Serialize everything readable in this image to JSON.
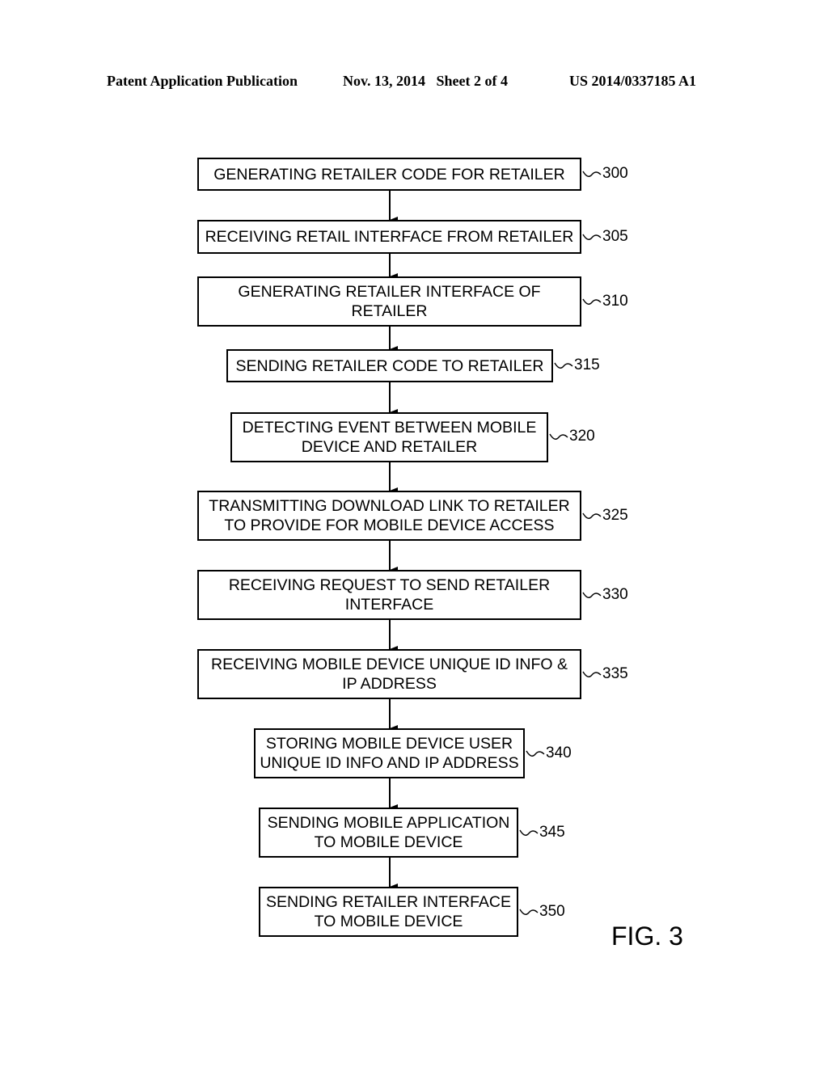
{
  "header": {
    "publication": "Patent Application Publication",
    "date_sheet": "Nov. 13, 2014   Sheet 2 of 4",
    "number": "US 2014/0337185 A1"
  },
  "figure_label": "FIG. 3",
  "steps": [
    {
      "ref": "300",
      "text": "GENERATING RETAILER CODE FOR RETAILER"
    },
    {
      "ref": "305",
      "text": "RECEIVING RETAIL INTERFACE FROM RETAILER"
    },
    {
      "ref": "310",
      "text": "GENERATING RETAILER INTERFACE OF\nRETAILER"
    },
    {
      "ref": "315",
      "text": "SENDING RETAILER CODE TO RETAILER"
    },
    {
      "ref": "320",
      "text": "DETECTING EVENT BETWEEN MOBILE\nDEVICE AND RETAILER"
    },
    {
      "ref": "325",
      "text": "TRANSMITTING DOWNLOAD LINK TO RETAILER\nTO PROVIDE FOR MOBILE DEVICE ACCESS"
    },
    {
      "ref": "330",
      "text": "RECEIVING REQUEST TO SEND RETAILER\nINTERFACE"
    },
    {
      "ref": "335",
      "text": "RECEIVING MOBILE DEVICE UNIQUE ID INFO &\nIP ADDRESS"
    },
    {
      "ref": "340",
      "text": "STORING MOBILE DEVICE USER\nUNIQUE ID INFO AND IP ADDRESS"
    },
    {
      "ref": "345",
      "text": "SENDING MOBILE APPLICATION\nTO MOBILE DEVICE"
    },
    {
      "ref": "350",
      "text": "SENDING RETAILER INTERFACE\nTO MOBILE DEVICE"
    }
  ]
}
